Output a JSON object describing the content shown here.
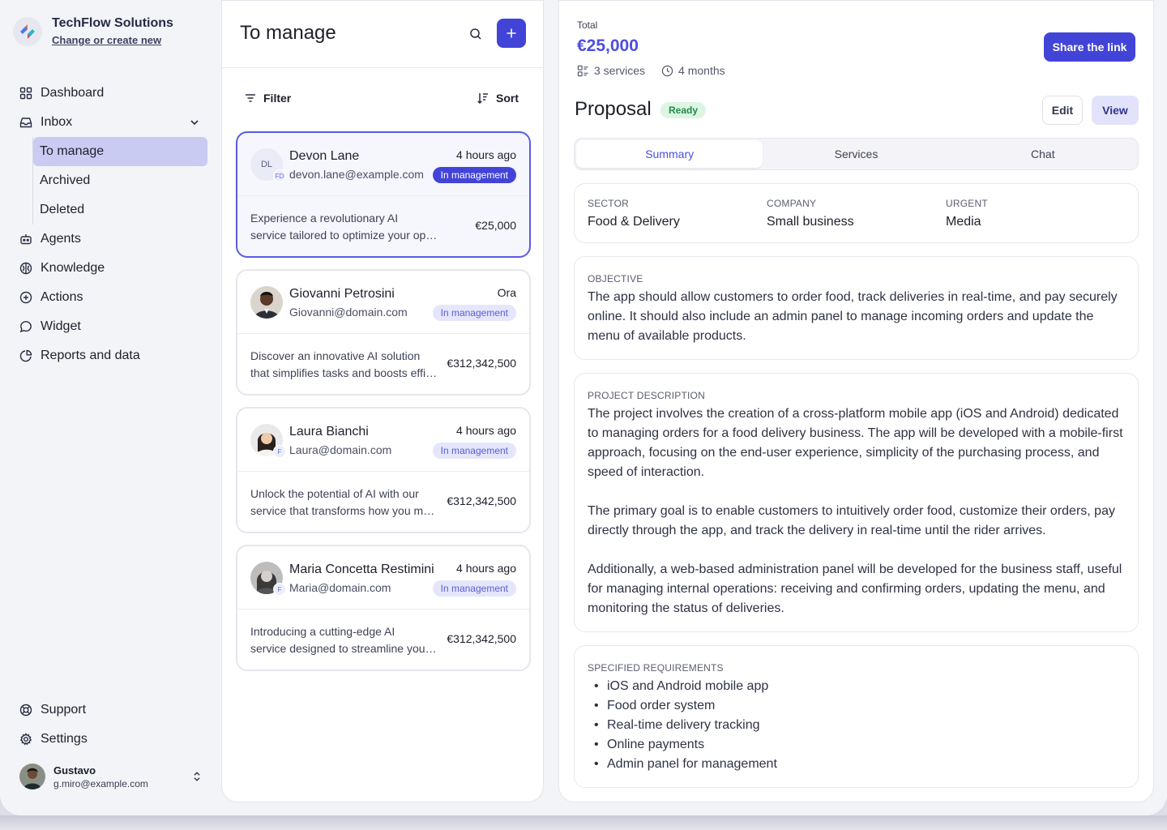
{
  "brand": {
    "name": "TechFlow Solutions",
    "sub_link": "Change or create new"
  },
  "nav": {
    "dashboard": "Dashboard",
    "inbox": "Inbox",
    "inbox_sub": [
      "To manage",
      "Archived",
      "Deleted"
    ],
    "agents": "Agents",
    "knowledge": "Knowledge",
    "actions": "Actions",
    "widget": "Widget",
    "reports": "Reports and data",
    "support": "Support",
    "settings": "Settings"
  },
  "user": {
    "name": "Gustavo",
    "email": "g.miro@example.com"
  },
  "list": {
    "title": "To manage",
    "filter_label": "Filter",
    "sort_label": "Sort",
    "cards": [
      {
        "initials": "DL",
        "mini": "FD",
        "name": "Devon Lane",
        "email": "devon.lane@example.com",
        "time": "4 hours ago",
        "status": "In management",
        "desc1": "Experience a revolutionary AI",
        "desc2": "service tailored to optimize your operations",
        "price": "€25,000"
      },
      {
        "mini": "",
        "name": "Giovanni Petrosini",
        "email": "Giovanni@domain.com",
        "time": "Ora",
        "status": "In management",
        "desc1": "Discover an innovative AI solution",
        "desc2": "that simplifies tasks and boosts efficiency",
        "price": "€312,342,500"
      },
      {
        "mini": "F",
        "name": "Laura Bianchi",
        "email": "Laura@domain.com",
        "time": "4 hours ago",
        "status": "In management",
        "desc1": "Unlock the potential of AI with our",
        "desc2": "service that transforms how you manage",
        "price": "€312,342,500"
      },
      {
        "mini": "F",
        "name": "Maria Concetta Restimini",
        "email": "Maria@domain.com",
        "time": "4 hours ago",
        "status": "In management",
        "desc1": "Introducing a cutting-edge AI",
        "desc2": "service designed to streamline your work",
        "price": "€312,342,500"
      }
    ]
  },
  "detail": {
    "total_label": "Total",
    "total_value": "€25,000",
    "services_count": "3 services",
    "duration": "4 months",
    "share_label": "Share the link",
    "title": "Proposal",
    "status": "Ready",
    "edit_label": "Edit",
    "view_label": "View",
    "tabs": [
      "Summary",
      "Services",
      "Chat"
    ],
    "info": {
      "sector_label": "Sector",
      "sector_value": "Food & Delivery",
      "company_label": "Company",
      "company_value": "Small business",
      "urgent_label": "Urgent",
      "urgent_value": "Media"
    },
    "objective_label": "Objective",
    "objective_text": "The app should allow customers to order food, track deliveries in real-time, and pay securely online. It should also include an admin panel to manage incoming orders and update the menu of available products.",
    "project_label": "Project description",
    "project_p1": "The project involves the creation of a cross-platform mobile app (iOS and Android) dedicated to managing orders for a food delivery business. The app will be developed with a mobile-first approach, focusing on the end-user experience, simplicity of the purchasing process, and speed of interaction.",
    "project_p2": "The primary goal is to enable customers to intuitively order food, customize their orders, pay directly through the app, and track the delivery in real-time until the rider arrives.",
    "project_p3": "Additionally, a web-based administration panel will be developed for the business staff, useful for managing internal operations: receiving and confirming orders, updating the menu, and monitoring the status of deliveries.",
    "requirements_label": "Specified requirements",
    "requirements": [
      "iOS and Android mobile app",
      "Food order system",
      "Real-time delivery tracking",
      "Online payments",
      "Admin panel for management"
    ]
  },
  "colors": {
    "accent": "#4244d8",
    "accent_soft": "#e5e6fb",
    "ready_bg": "#dcf6e3",
    "ready_text": "#238a4a"
  }
}
